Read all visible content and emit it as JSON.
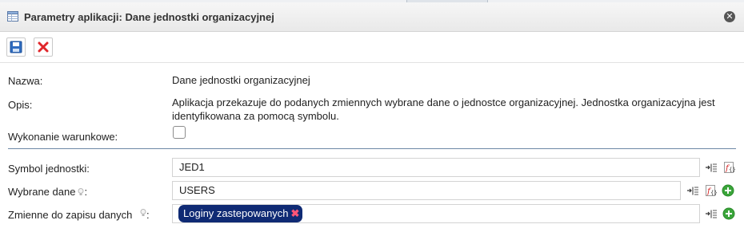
{
  "dialog": {
    "title": "Parametry aplikacji: Dane jednostki organizacyjnej"
  },
  "toolbar": {
    "save_icon": "save-icon",
    "cancel_icon": "cancel-icon"
  },
  "info": {
    "name_label": "Nazwa:",
    "name_value": "Dane jednostki organizacyjnej",
    "desc_label": "Opis:",
    "desc_line1": "Aplikacja przekazuje do podanych zmiennych wybrane dane o jednostce organizacyjnej. Jednostka organizacyjna jest",
    "desc_line2": "identyfikowana za pomocą symbolu.",
    "conditional_label": "Wykonanie warunkowe:",
    "conditional_checked": false
  },
  "params": {
    "symbol_label": "Symbol jednostki:",
    "symbol_value": "JED1",
    "data_label": "Wybrane dane",
    "data_value": "USERS",
    "vars_label": "Zmienne do zapisu danych",
    "vars_tag": "Loginy zastepowanych"
  },
  "colors": {
    "separator": "#6d87a6",
    "tag_bg": "#0f2a74",
    "tag_remove": "#ff5577",
    "add_green": "#3aa53a",
    "cancel_red": "#e0262b"
  }
}
